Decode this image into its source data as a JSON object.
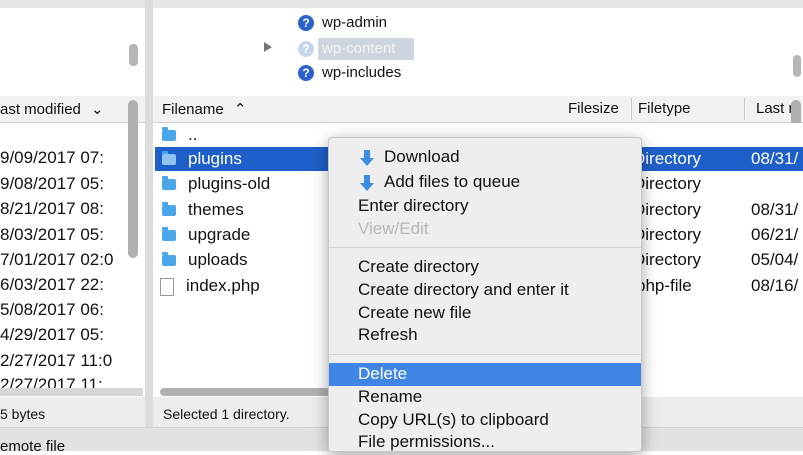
{
  "remote_tree": {
    "items": [
      {
        "label": "wp-admin"
      },
      {
        "label": "wp-content"
      },
      {
        "label": "wp-includes"
      }
    ]
  },
  "local_panel": {
    "column_header": "ast modified",
    "dates": [
      "9/09/2017 07:",
      "9/08/2017 05:",
      "8/21/2017 08:",
      "8/03/2017 05:",
      "7/01/2017 02:0",
      "6/03/2017 22:",
      "5/08/2017 06:",
      "4/29/2017 05:",
      "2/27/2017 11:0",
      "2/27/2017 11:"
    ],
    "status": "5 bytes"
  },
  "remote_panel": {
    "headers": {
      "filename": "Filename",
      "filesize": "Filesize",
      "filetype": "Filetype",
      "last_modified": "Last m"
    },
    "files": [
      {
        "name": "..",
        "type": "",
        "modified": ""
      },
      {
        "name": "plugins",
        "type": "Directory",
        "modified": "08/31/"
      },
      {
        "name": "plugins-old",
        "type": "Directory",
        "modified": ""
      },
      {
        "name": "themes",
        "type": "Directory",
        "modified": "08/31/"
      },
      {
        "name": "upgrade",
        "type": "Directory",
        "modified": "06/21/"
      },
      {
        "name": "uploads",
        "type": "Directory",
        "modified": "05/04/"
      },
      {
        "name": "index.php",
        "type": "php-file",
        "modified": "08/16/"
      }
    ],
    "status": "Selected 1 directory."
  },
  "bottom_bar": {
    "label": "emote file"
  },
  "context_menu": {
    "download": "Download",
    "add_to_queue": "Add files to queue",
    "enter_directory": "Enter directory",
    "view_edit": "View/Edit",
    "create_directory": "Create directory",
    "create_directory_enter": "Create directory and enter it",
    "create_new_file": "Create new file",
    "refresh": "Refresh",
    "delete": "Delete",
    "rename": "Rename",
    "copy_url": "Copy URL(s) to clipboard",
    "file_permissions": "File permissions..."
  },
  "colors": {
    "selection": "#1f5fc9",
    "menu_highlight": "#3f86e6",
    "folder": "#4aa6e8"
  }
}
